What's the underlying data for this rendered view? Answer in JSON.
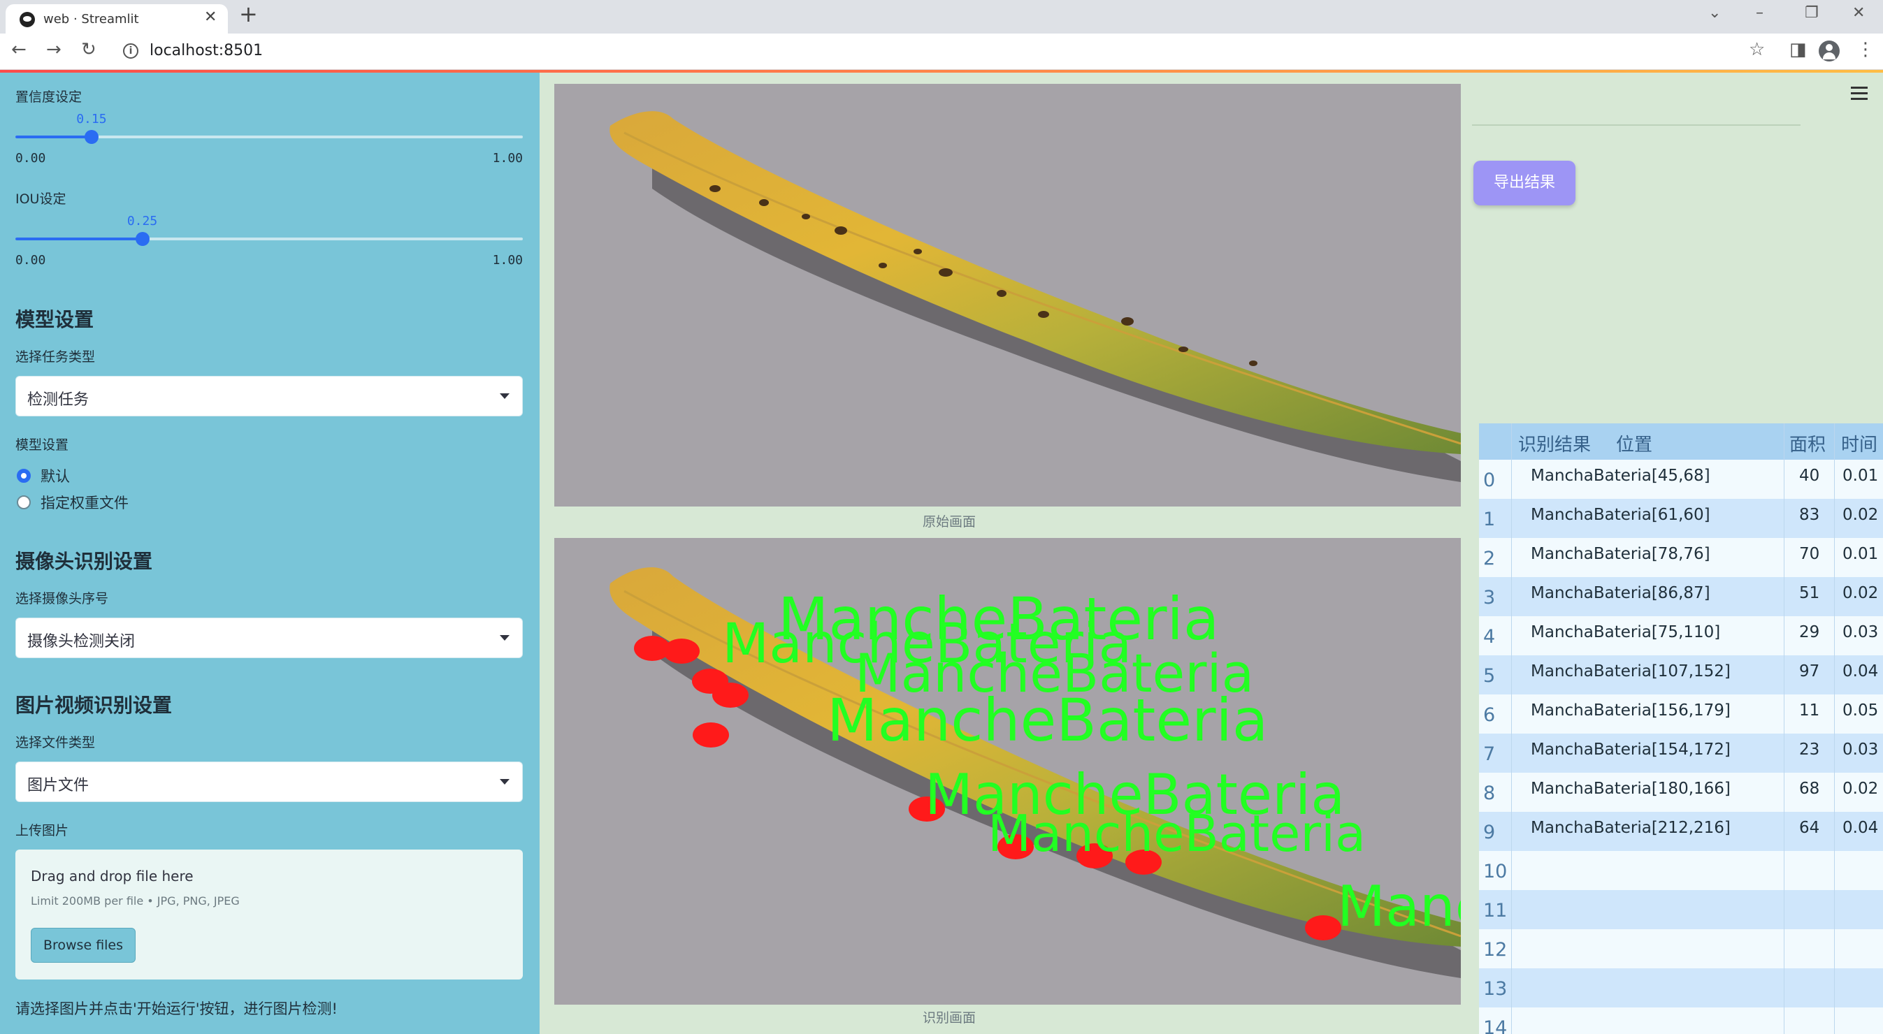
{
  "browser": {
    "tab_title": "web · Streamlit",
    "url": "localhost:8501"
  },
  "sidebar": {
    "confidence": {
      "label": "置信度设定",
      "value_text": "0.15",
      "value": 0.15,
      "min": "0.00",
      "max": "1.00"
    },
    "iou": {
      "label": "IOU设定",
      "value_text": "0.25",
      "value": 0.25,
      "min": "0.00",
      "max": "1.00"
    },
    "model_section": {
      "heading": "模型设置",
      "task_label": "选择任务类型",
      "task_value": "检测任务",
      "weights_label": "模型设置",
      "radio_default": "默认",
      "radio_custom": "指定权重文件"
    },
    "camera_section": {
      "heading": "摄像头识别设置",
      "camera_label": "选择摄像头序号",
      "camera_value": "摄像头检测关闭"
    },
    "media_section": {
      "heading": "图片视频识别设置",
      "file_type_label": "选择文件类型",
      "file_type_value": "图片文件",
      "upload_label": "上传图片",
      "upload_title": "Drag and drop file here",
      "upload_limit": "Limit 200MB per file • JPG, PNG, JPEG",
      "browse_label": "Browse files"
    },
    "hint": "请选择图片并点击'开始运行'按钮，进行图片检测!"
  },
  "main": {
    "original_caption": "原始画面",
    "result_caption": "识别画面",
    "export_label": "导出结果",
    "detection_label": "MancheBateria"
  },
  "table": {
    "headers": {
      "result": "识别结果",
      "position": "位置",
      "area": "面积",
      "time": "时间"
    },
    "rows": [
      {
        "idx": "0",
        "result": "ManchaBateria",
        "position": "[45,68]",
        "area": "40",
        "time": "0.01"
      },
      {
        "idx": "1",
        "result": "ManchaBateria",
        "position": "[61,60]",
        "area": "83",
        "time": "0.02"
      },
      {
        "idx": "2",
        "result": "ManchaBateria",
        "position": "[78,76]",
        "area": "70",
        "time": "0.01"
      },
      {
        "idx": "3",
        "result": "ManchaBateria",
        "position": "[86,87]",
        "area": "51",
        "time": "0.02"
      },
      {
        "idx": "4",
        "result": "ManchaBateria",
        "position": "[75,110]",
        "area": "29",
        "time": "0.03"
      },
      {
        "idx": "5",
        "result": "ManchaBateria",
        "position": "[107,152]",
        "area": "97",
        "time": "0.04"
      },
      {
        "idx": "6",
        "result": "ManchaBateria",
        "position": "[156,179]",
        "area": "11",
        "time": "0.05"
      },
      {
        "idx": "7",
        "result": "ManchaBateria",
        "position": "[154,172]",
        "area": "23",
        "time": "0.03"
      },
      {
        "idx": "8",
        "result": "ManchaBateria",
        "position": "[180,166]",
        "area": "68",
        "time": "0.02"
      },
      {
        "idx": "9",
        "result": "ManchaBateria",
        "position": "[212,216]",
        "area": "64",
        "time": "0.04"
      },
      {
        "idx": "10",
        "result": "",
        "position": "",
        "area": "",
        "time": ""
      },
      {
        "idx": "11",
        "result": "",
        "position": "",
        "area": "",
        "time": ""
      },
      {
        "idx": "12",
        "result": "",
        "position": "",
        "area": "",
        "time": ""
      },
      {
        "idx": "13",
        "result": "",
        "position": "",
        "area": "",
        "time": ""
      },
      {
        "idx": "14",
        "result": "",
        "position": "",
        "area": "",
        "time": ""
      }
    ]
  },
  "icons": {
    "favicon": "streamlit-icon",
    "back": "arrow-left-icon",
    "forward": "arrow-right-icon",
    "reload": "reload-icon",
    "info": "info-icon",
    "star": "star-icon",
    "sidebar_toggle": "side-panel-icon",
    "profile": "profile-icon",
    "menu": "hamburger-menu-icon"
  },
  "colors": {
    "sidebar_bg": "#79c5d8",
    "main_bg": "#d7e8d5",
    "accent": "#2a6cf2",
    "export_button": "#9d95f5",
    "detection_box": "#ff1a1a",
    "detection_text": "#22ff22",
    "table_header": "#a9d2f1"
  }
}
